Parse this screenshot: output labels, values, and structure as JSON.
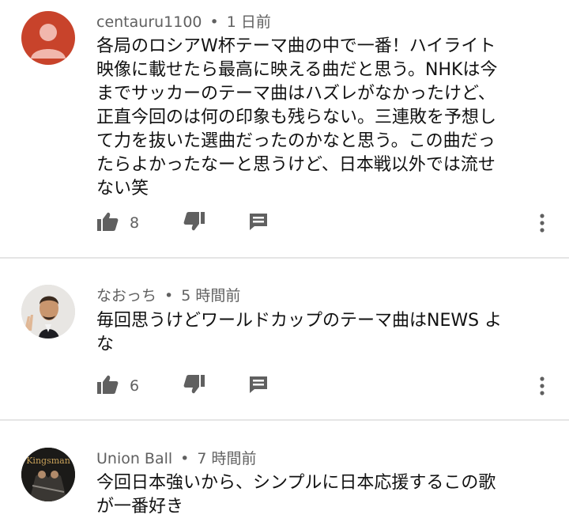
{
  "comments": [
    {
      "author": "centauru1100",
      "time": "1 日前",
      "text": "各局のロシアW杯テーマ曲の中で一番！ハイライト\n映像に載せたら最高に映える曲だと思う。NHKは今\nまでサッカーのテーマ曲はハズレがなかったけど、\n正直今回のは何の印象も残らない。三連敗を予想し\nて力を抜いた選曲だったのかなと思う。この曲だっ\nたらよかったなーと思うけど、日本戦以外では流せ\nない笑",
      "likes": "8",
      "avatar_color": "#c8432b"
    },
    {
      "author": "なおっち",
      "time": "5 時間前",
      "text": "毎回思うけどワールドカップのテーマ曲はNEWS よ\nな",
      "likes": "6"
    },
    {
      "author": "Union Ball",
      "time": "7 時間前",
      "text": "今回日本強いから、シンプルに日本応援するこの歌\nが一番好き",
      "avatar_text": "Kingsman"
    }
  ],
  "colors": {
    "icon": "#606060",
    "divider": "#e5e5e5"
  }
}
